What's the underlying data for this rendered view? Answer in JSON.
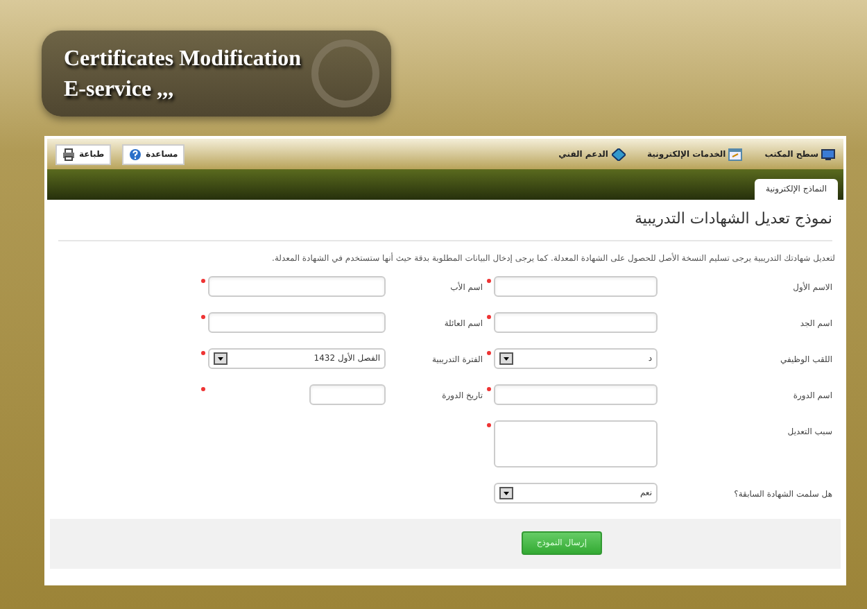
{
  "banner": {
    "title_line_1": "Certificates Modification",
    "title_line_2": "E-service ,,,"
  },
  "toolbar": {
    "links": [
      "سطح المكتب",
      "الخدمات الإلكترونية",
      "الدعم الفني"
    ],
    "buttons": [
      "مساعدة",
      "طباعة"
    ]
  },
  "tabs": [
    {
      "label": "النماذج الإلكترونية",
      "selected": true
    }
  ],
  "form": {
    "title": "نموذج تعديل الشهادات التدريبية",
    "intro": "لتعديل شهادتك التدريبية يرجى تسليم النسخة الأصل للحصول على الشهادة المعدلة. كما يرجى إدخال البيانات المطلوبة بدقة حيث أنها ستستخدم في الشهادة المعدلة.",
    "rows": [
      [
        {
          "label": "الاسم الأول",
          "kind": "text",
          "required": true
        },
        {
          "label": "اسم الأب",
          "kind": "text",
          "required": true
        }
      ],
      [
        {
          "label": "اسم الجد",
          "kind": "text",
          "required": true
        },
        {
          "label": "اسم العائلة",
          "kind": "text",
          "required": true
        }
      ],
      [
        {
          "label": "اللقب الوظيفي",
          "kind": "select",
          "value": "د",
          "required": true
        },
        {
          "label": "الفترة التدريبية",
          "kind": "select",
          "value": "الفصل الأول 1432",
          "required": true
        }
      ],
      [
        {
          "label": "اسم الدورة",
          "kind": "text",
          "required": true
        },
        {
          "label": "تاريخ الدورة",
          "kind": "short",
          "required": true
        }
      ],
      [
        {
          "label": "سبب التعديل",
          "kind": "textarea",
          "required": true
        }
      ],
      [
        {
          "label": "هل سلمت الشهادة السابقة؟",
          "kind": "select",
          "value": "نعم",
          "required": false
        }
      ]
    ],
    "submit": "إرسال النموذج"
  }
}
